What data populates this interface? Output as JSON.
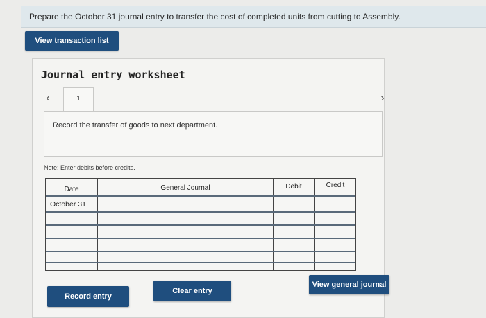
{
  "question": {
    "text": "Prepare the October 31 journal entry to transfer the cost of completed units from cutting to Assembly."
  },
  "buttons": {
    "view_transaction_list": "View transaction list",
    "record_entry": "Record entry",
    "clear_entry": "Clear entry",
    "view_general_journal": "View general journal"
  },
  "worksheet": {
    "title": "Journal entry worksheet",
    "nav_prev_icon": "chevron-left-icon",
    "nav_next_icon": "chevron-right-icon",
    "active_tab": "1",
    "instruction": "Record the transfer of goods to next department.",
    "note": "Note: Enter debits before credits."
  },
  "journal": {
    "headers": {
      "date": "Date",
      "general_journal": "General Journal",
      "debit": "Debit",
      "credit": "Credit"
    },
    "rows": [
      {
        "date": "October 31",
        "account": "",
        "debit": "",
        "credit": ""
      },
      {
        "date": "",
        "account": "",
        "debit": "",
        "credit": ""
      },
      {
        "date": "",
        "account": "",
        "debit": "",
        "credit": ""
      },
      {
        "date": "",
        "account": "",
        "debit": "",
        "credit": ""
      },
      {
        "date": "",
        "account": "",
        "debit": "",
        "credit": ""
      },
      {
        "date": "",
        "account": "",
        "debit": "",
        "credit": ""
      }
    ]
  },
  "colors": {
    "button_bg": "#1f4e7e",
    "question_bg": "#dfe8ec",
    "grid_line": "#5a6a7a"
  }
}
